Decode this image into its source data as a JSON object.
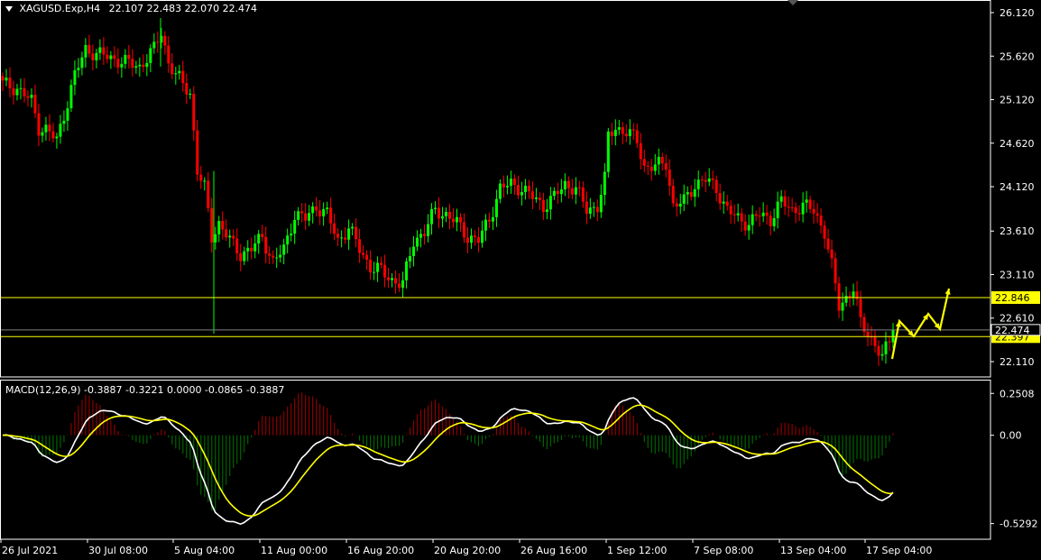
{
  "header": {
    "symbol": "XAGUSD.Exp,H4",
    "ohlc": "22.107 22.483 22.070 22.474"
  },
  "macd_header": "MACD(12,26,9) -0.3887 -0.3221 0.0000 -0.0865 -0.3887",
  "colors": {
    "background": "#000000",
    "bull": "#00ff00",
    "bear": "#ff0000",
    "level_line": "#ffff00",
    "macd_main": "#ffffff",
    "macd_signal": "#ffff00",
    "hist_pos": "#8b0000",
    "hist_neg": "#006400",
    "arrows": "#ffff00"
  },
  "chart_data": [
    {
      "type": "candlestick",
      "symbol": "XAGUSD",
      "timeframe": "H4",
      "y_ticks": [
        "26.120",
        "25.620",
        "25.120",
        "24.620",
        "24.120",
        "23.610",
        "23.110",
        "22.610",
        "22.110"
      ],
      "ylim": [
        21.95,
        26.18
      ],
      "levels": [
        {
          "value": 22.846,
          "label": "22.846"
        },
        {
          "value": 22.397,
          "label": "22.397"
        }
      ],
      "price_marker": {
        "value": 22.474,
        "label": "22.474"
      },
      "x_ticks": [
        "26 Jul 2021",
        "30 Jul 08:00",
        "5 Aug 04:00",
        "11 Aug 00:00",
        "16 Aug 20:00",
        "20 Aug 20:00",
        "26 Aug 16:00",
        "1 Sep 12:00",
        "7 Sep 08:00",
        "13 Sep 04:00",
        "17 Sep 04:00"
      ],
      "anchors": [
        [
          0,
          25.3
        ],
        [
          4,
          25.25
        ],
        [
          8,
          25.1
        ],
        [
          10,
          24.8
        ],
        [
          12,
          24.78
        ],
        [
          15,
          24.65
        ],
        [
          18,
          25.1
        ],
        [
          20,
          25.4
        ],
        [
          23,
          25.7
        ],
        [
          26,
          25.65
        ],
        [
          30,
          25.6
        ],
        [
          34,
          25.55
        ],
        [
          38,
          25.5
        ],
        [
          42,
          25.7
        ],
        [
          44,
          25.9
        ],
        [
          46,
          25.55
        ],
        [
          48,
          25.4
        ],
        [
          50,
          25.3
        ],
        [
          52,
          25.2
        ],
        [
          54,
          24.3
        ],
        [
          56,
          24.1
        ],
        [
          58,
          23.55
        ],
        [
          60,
          23.7
        ],
        [
          63,
          23.5
        ],
        [
          66,
          23.35
        ],
        [
          69,
          23.4
        ],
        [
          72,
          23.55
        ],
        [
          75,
          23.25
        ],
        [
          78,
          23.4
        ],
        [
          81,
          23.8
        ],
        [
          84,
          23.75
        ],
        [
          87,
          23.9
        ],
        [
          90,
          23.8
        ],
        [
          93,
          23.5
        ],
        [
          96,
          23.65
        ],
        [
          99,
          23.4
        ],
        [
          102,
          23.2
        ],
        [
          105,
          23.15
        ],
        [
          108,
          23.05
        ],
        [
          111,
          23.0
        ],
        [
          114,
          23.5
        ],
        [
          117,
          23.6
        ],
        [
          120,
          23.85
        ],
        [
          123,
          23.8
        ],
        [
          126,
          23.7
        ],
        [
          129,
          23.55
        ],
        [
          132,
          23.5
        ],
        [
          135,
          23.75
        ],
        [
          138,
          24.1
        ],
        [
          141,
          24.15
        ],
        [
          144,
          24.1
        ],
        [
          147,
          24.0
        ],
        [
          150,
          23.9
        ],
        [
          153,
          24.0
        ],
        [
          156,
          24.15
        ],
        [
          159,
          24.1
        ],
        [
          162,
          23.85
        ],
        [
          165,
          23.9
        ],
        [
          167,
          24.2
        ],
        [
          168,
          24.7
        ],
        [
          170,
          24.8
        ],
        [
          173,
          24.75
        ],
        [
          176,
          24.65
        ],
        [
          178,
          24.35
        ],
        [
          181,
          24.35
        ],
        [
          184,
          24.4
        ],
        [
          186,
          23.9
        ],
        [
          189,
          23.95
        ],
        [
          192,
          24.15
        ],
        [
          195,
          24.2
        ],
        [
          198,
          24.1
        ],
        [
          201,
          23.85
        ],
        [
          204,
          23.75
        ],
        [
          207,
          23.7
        ],
        [
          210,
          23.8
        ],
        [
          213,
          23.75
        ],
        [
          216,
          23.95
        ],
        [
          219,
          23.85
        ],
        [
          222,
          23.9
        ],
        [
          225,
          23.85
        ],
        [
          228,
          23.6
        ],
        [
          230,
          23.2
        ],
        [
          232,
          22.75
        ],
        [
          234,
          22.85
        ],
        [
          236,
          22.95
        ],
        [
          238,
          22.55
        ],
        [
          240,
          22.45
        ],
        [
          242,
          22.3
        ],
        [
          244,
          22.15
        ],
        [
          246,
          22.35
        ],
        [
          247,
          22.474
        ]
      ],
      "forecast_arrows": [
        "up",
        "down",
        "up",
        "down",
        "up"
      ]
    },
    {
      "type": "macd",
      "params": "12,26,9",
      "y_ticks": [
        "0.2508",
        "0.00",
        "-0.5292"
      ],
      "ylim": [
        -0.58,
        0.29
      ]
    }
  ]
}
